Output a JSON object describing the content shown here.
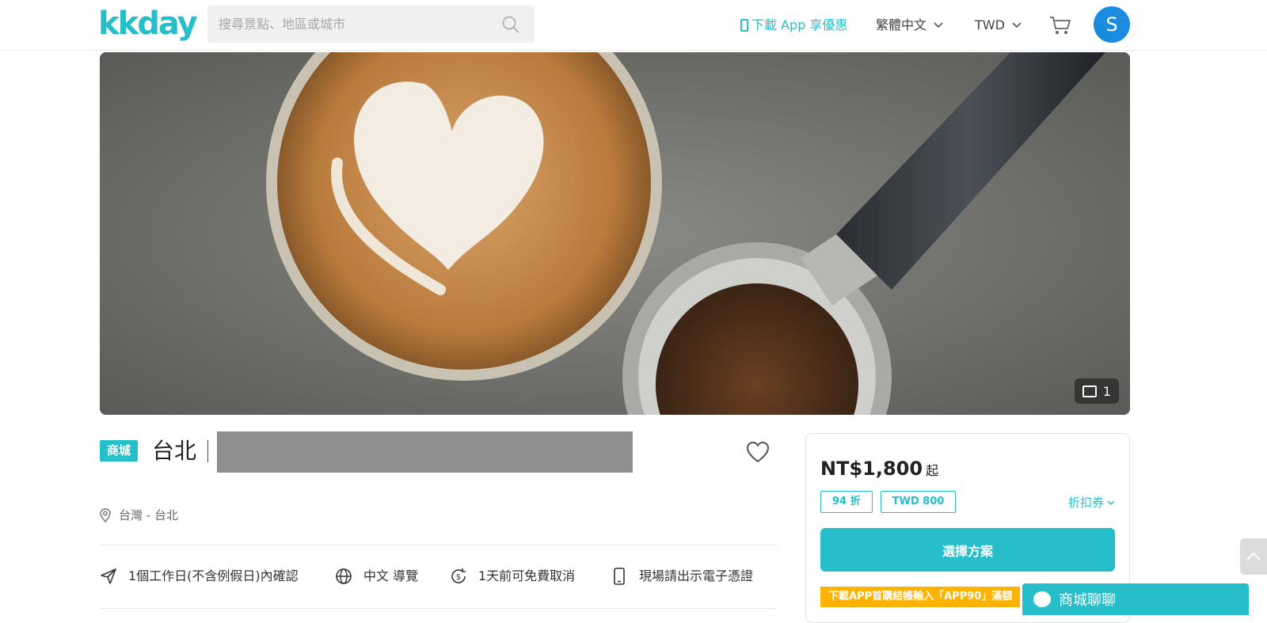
{
  "header": {
    "logo": "kkday",
    "search_placeholder": "搜尋景點、地區或城市",
    "app_link": "下載 App 享優惠",
    "language": "繁體中文",
    "currency": "TWD",
    "avatar_initial": "S"
  },
  "hero": {
    "photo_count": "1"
  },
  "product": {
    "tag": "商城",
    "title_city": "台北",
    "location": "台灣 - 台北",
    "features": [
      {
        "icon": "send-icon",
        "label": "1個工作日(不含例假日)內確認"
      },
      {
        "icon": "globe-icon",
        "label": "中文 導覽"
      },
      {
        "icon": "refund-icon",
        "label": "1天前可免費取消"
      },
      {
        "icon": "mobile-icon",
        "label": "現場請出示電子憑證"
      }
    ]
  },
  "pricing": {
    "price": "NT$1,800",
    "from_label": "起",
    "discount_chip": "94 折",
    "amount_chip": "TWD 800",
    "coupon_label": "折扣券",
    "select_button": "選擇方案",
    "promo_text": "下載APP首購結帳輸入「APP90」滿額"
  },
  "chat": {
    "label": "商城聊聊"
  },
  "colors": {
    "brand": "#26bec9",
    "avatar": "#1a8ce0",
    "promo": "#ffb300"
  }
}
